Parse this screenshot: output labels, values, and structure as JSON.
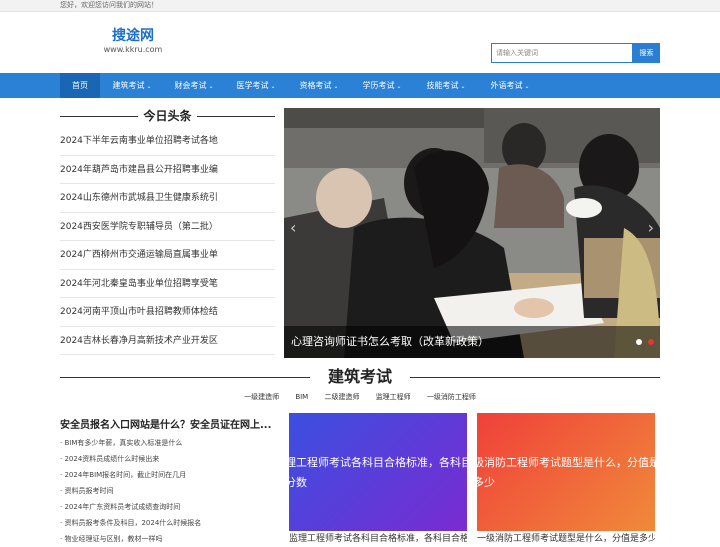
{
  "topbar": {
    "greeting": "您好，欢迎您访问我们的网站！"
  },
  "logo": {
    "name": "搜途网",
    "url": "www.kkru.com"
  },
  "search": {
    "placeholder": "请输入关键词",
    "button": "搜索"
  },
  "nav": {
    "items": [
      {
        "label": "首页",
        "has_menu": false,
        "active": true
      },
      {
        "label": "建筑考试",
        "has_menu": true
      },
      {
        "label": "财会考试",
        "has_menu": true
      },
      {
        "label": "医学考试",
        "has_menu": true
      },
      {
        "label": "资格考试",
        "has_menu": true
      },
      {
        "label": "学历考试",
        "has_menu": true
      },
      {
        "label": "技能考试",
        "has_menu": true
      },
      {
        "label": "外语考试",
        "has_menu": true
      }
    ]
  },
  "headlines": {
    "title": "今日头条",
    "items": [
      "2024下半年云南事业单位招聘考试各地",
      "2024年葫芦岛市建昌县公开招聘事业编",
      "2024山东德州市武城县卫生健康系统引",
      "2024西安医学院专职辅导员（第二批）",
      "2024广西柳州市交通运输局直属事业单",
      "2024年河北秦皇岛事业单位招聘享受笔",
      "2024河南平顶山市叶县招聘教师体检结",
      "2024吉林长春净月高新技术产业开发区"
    ]
  },
  "slider": {
    "caption": "心理咨询师证书怎么考取（改革新政策）",
    "slide_count": 2,
    "active_index": 1
  },
  "section": {
    "title": "建筑考试",
    "subtabs": [
      "一级建造师",
      "BIM",
      "二级建造师",
      "监理工程师",
      "一级消防工程师"
    ],
    "article_title": "安全员报名入口网站是什么？安全员证在网上...",
    "articles": [
      "BIM有多少年薪，真实收入标准是什么",
      "2024资料员成绩什么时候出来",
      "2024年BIM报名时间，截止时间在几月",
      "资料员报考时间",
      "2024年广东资料员考试成绩查询时间",
      "资料员报考条件及科目，2024什么时候报名",
      "物业经理证与区别，教材一样吗"
    ],
    "cards": [
      {
        "text": "理工程师考试各科目合格标准，各科目分数",
        "caption": "监理工程师考试各科目合格标准，各科目合格分数"
      },
      {
        "text": "级消防工程师考试题型是什么，分值是多少",
        "caption": "一级消防工程师考试题型是什么，分值是多少"
      }
    ]
  },
  "colors": {
    "brand_blue": "#2a81d6",
    "nav_active": "#1866b4",
    "card1_gradient": [
      "#3b4fe0",
      "#7a2bd1"
    ],
    "card2_gradient": [
      "#f0403a",
      "#f08a3a"
    ]
  }
}
